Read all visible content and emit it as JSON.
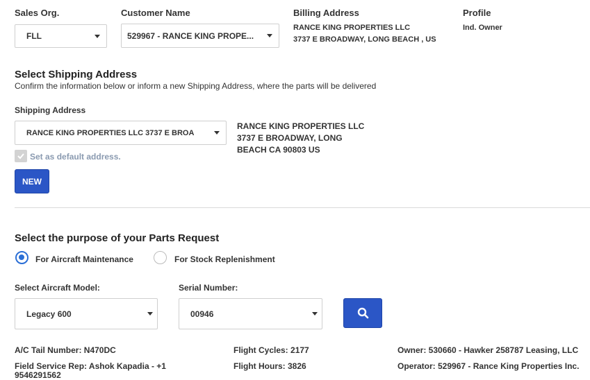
{
  "header": {
    "sales_org": {
      "label": "Sales Org.",
      "value": "FLL"
    },
    "customer": {
      "label": "Customer Name",
      "value": "529967 - RANCE KING PROPE..."
    },
    "billing": {
      "label": "Billing Address",
      "line1": "RANCE KING PROPERTIES LLC",
      "line2": "3737 E BROADWAY, LONG BEACH , US"
    },
    "profile": {
      "label": "Profile",
      "value": "Ind. Owner"
    }
  },
  "shipping": {
    "title": "Select Shipping Address",
    "subtitle": "Confirm the information below or inform a new Shipping Address, where the parts will be delivered",
    "field_label": "Shipping Address",
    "selected": "RANCE KING PROPERTIES LLC 3737 E BROA",
    "address_line1": "RANCE KING PROPERTIES LLC",
    "address_line2": "3737 E BROADWAY, LONG",
    "address_line3": "BEACH CA 90803 US",
    "default_label": "Set as default address.",
    "default_checked": true,
    "new_button": "NEW"
  },
  "purpose": {
    "title": "Select the purpose of your Parts Request",
    "options": [
      "For Aircraft Maintenance",
      "For Stock Replenishment"
    ],
    "selected_index": 0
  },
  "aircraft": {
    "model_label": "Select Aircraft Model:",
    "model_value": "Legacy 600",
    "serial_label": "Serial Number:",
    "serial_value": "00946",
    "search_icon": "search-icon"
  },
  "details": {
    "tail": "A/C Tail Number: N470DC",
    "rep": "Field Service Rep: Ashok Kapadia - +1 9546291562",
    "cycles": "Flight Cycles: 2177",
    "hours": "Flight Hours: 3826",
    "owner": "Owner: 530660 - Hawker 258787 Leasing, LLC",
    "operator": "Operator: 529967 - Rance King Properties Inc."
  },
  "colors": {
    "accent": "#2b56c6",
    "radio": "#2b6fd6",
    "divider": "#d9d9d9"
  }
}
